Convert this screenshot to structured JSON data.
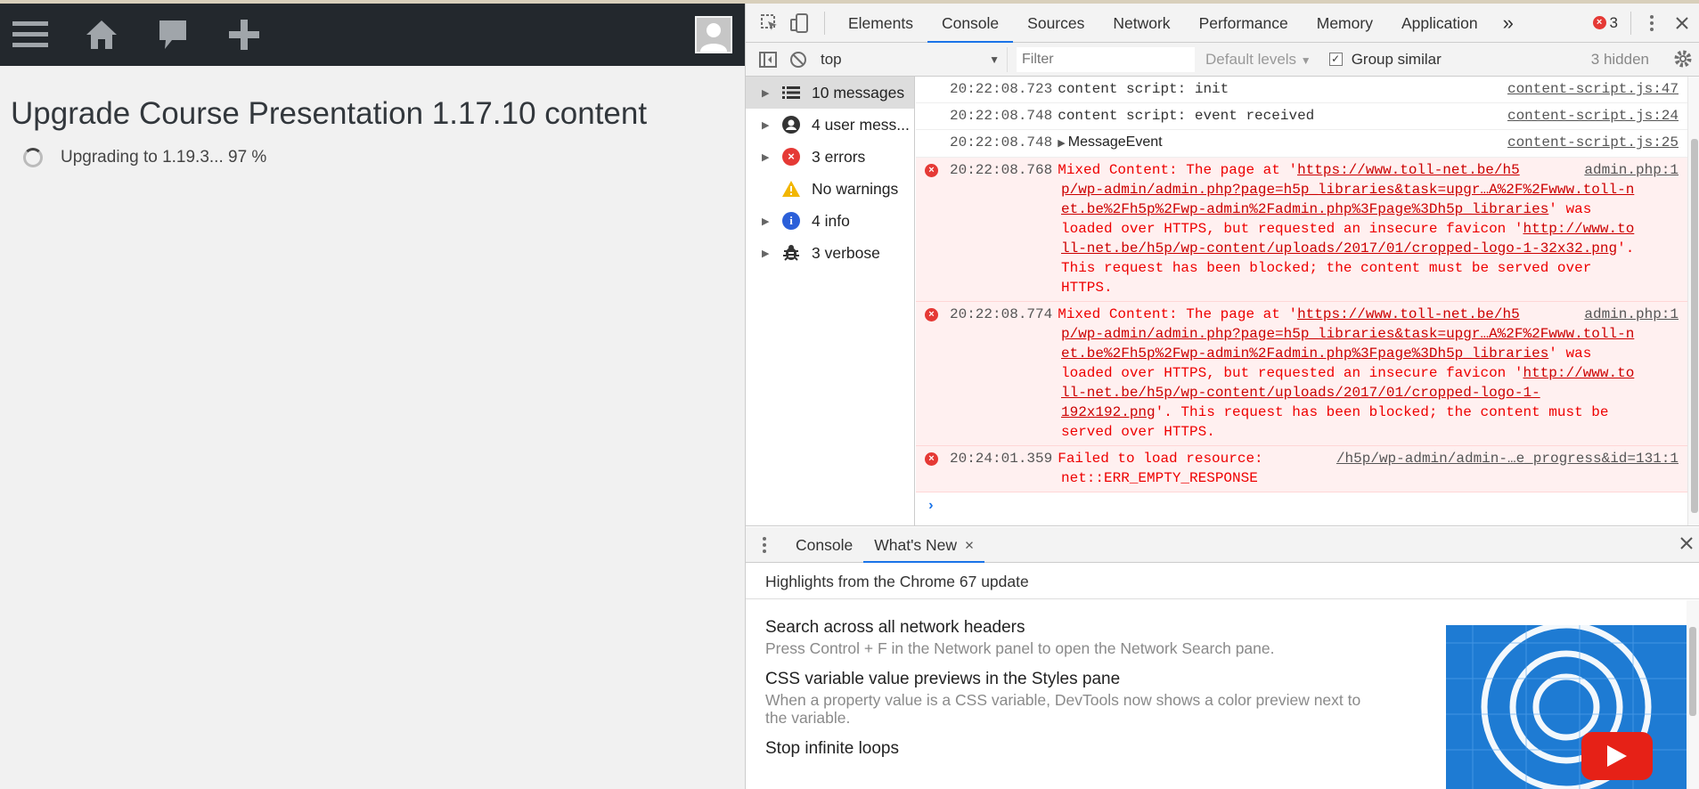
{
  "page": {
    "title": "Upgrade Course Presentation 1.17.10 content",
    "progress": "Upgrading to 1.19.3... 97 %"
  },
  "devtools": {
    "tabs": [
      "Elements",
      "Console",
      "Sources",
      "Network",
      "Performance",
      "Memory",
      "Application"
    ],
    "more_tabs": "»",
    "error_count": "3",
    "context": "top",
    "filter_placeholder": "Filter",
    "levels": "Default levels",
    "group_similar": "Group similar",
    "hidden": "3 hidden",
    "sidebar": [
      {
        "label": "10 messages",
        "icon": "list-icon"
      },
      {
        "label": "4 user mess...",
        "icon": "user-icon"
      },
      {
        "label": "3 errors",
        "icon": "error-icon"
      },
      {
        "label": "No warnings",
        "icon": "warning-icon"
      },
      {
        "label": "4 info",
        "icon": "info-icon"
      },
      {
        "label": "3 verbose",
        "icon": "bug-icon"
      }
    ],
    "messages": [
      {
        "ts": "20:22:08.723",
        "text": "content script: init",
        "src": "content-script.js:47"
      },
      {
        "ts": "20:22:08.748",
        "text": "content script: event received",
        "src": "content-script.js:24"
      },
      {
        "ts": "20:22:08.748",
        "text": "MessageEvent",
        "src": "content-script.js:25"
      }
    ],
    "errors": [
      {
        "ts": "20:22:08.768",
        "src": "admin.php:1",
        "l1_pre": "Mixed Content: The page at '",
        "l1_link": "https://www.toll-net.be/h5",
        "l2_link": "p/wp-admin/admin.php?page=h5p_libraries&task=upgr…A%2F%2Fwww.toll-n",
        "l3_link": "et.be%2Fh5p%2Fwp-admin%2Fadmin.php%3Fpage%3Dh5p_libraries",
        "l3_post": "' was",
        "l4_pre": "loaded over HTTPS, but requested an insecure favicon '",
        "l4_link": "http://www.to",
        "l5_link": "ll-net.be/h5p/wp-content/uploads/2017/01/cropped-logo-1-32x32.png",
        "l5_post": "'.",
        "l6": "This request has been blocked; the content must be served over",
        "l7": "HTTPS."
      },
      {
        "ts": "20:22:08.774",
        "src": "admin.php:1",
        "l1_pre": "Mixed Content: The page at '",
        "l1_link": "https://www.toll-net.be/h5",
        "l2_link": "p/wp-admin/admin.php?page=h5p_libraries&task=upgr…A%2F%2Fwww.toll-n",
        "l3_link": "et.be%2Fh5p%2Fwp-admin%2Fadmin.php%3Fpage%3Dh5p_libraries",
        "l3_post": "' was",
        "l4_pre": "loaded over HTTPS, but requested an insecure favicon '",
        "l4_link": "http://www.to",
        "l5_link": "ll-net.be/h5p/wp-content/uploads/2017/01/cropped-logo-1-",
        "l6_link": "192x192.png",
        "l6_post": "'. This request has been blocked; the content must be",
        "l7": "served over HTTPS."
      },
      {
        "ts": "20:24:01.359",
        "text": "Failed to load resource:",
        "src": "/h5p/wp-admin/admin-…e_progress&id=131:1",
        "l2": "net::ERR_EMPTY_RESPONSE"
      }
    ],
    "prompt": "›",
    "drawer": {
      "tabs": [
        "Console",
        "What's New"
      ],
      "close_tab": "×",
      "heading": "Highlights from the Chrome 67 update",
      "features": [
        {
          "title": "Search across all network headers",
          "desc": "Press Control + F in the Network panel to open the Network Search pane."
        },
        {
          "title": "CSS variable value previews in the Styles pane",
          "desc": "When a property value is a CSS variable, DevTools now shows a color preview next to the variable."
        },
        {
          "title": "Stop infinite loops",
          "desc": ""
        }
      ]
    }
  },
  "colors": {
    "accent": "#1a73e8",
    "error": "#e53935",
    "wpbar": "#23282d",
    "promo": "#1e7bd3",
    "youtube": "#e62117"
  }
}
